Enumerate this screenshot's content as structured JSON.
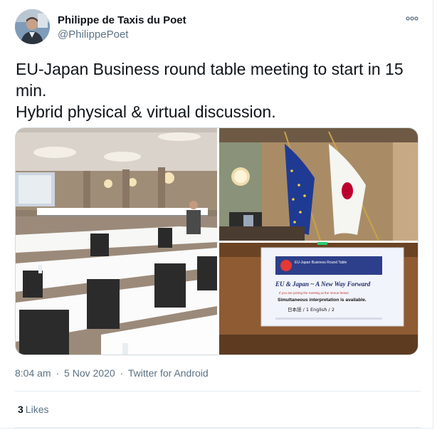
{
  "author": {
    "display_name": "Philippe de Taxis du Poet",
    "handle": "@PhilippePoet"
  },
  "more_icon": "more-options-icon",
  "tweet": {
    "lines": [
      "EU-Japan Business round table meeting to start in 15",
      "min.",
      "Hybrid physical & virtual discussion."
    ]
  },
  "media": {
    "screen": {
      "header": "EU-Japan Business Round Table",
      "title": "EU & Japan ~ A New Way Forward",
      "sub1": "If you are joining the meeting at the Venue below:",
      "sub2": "Simultaneous interpretation is available.",
      "sub3": "日本語 / 1  English / 2"
    }
  },
  "meta": {
    "time": "8:04 am",
    "separator": "·",
    "date": "5 Nov 2020",
    "source": "Twitter for Android"
  },
  "likes": {
    "count": "3",
    "label": "Likes"
  },
  "colors": {
    "text": "#0f1419",
    "secondary": "#5b7083",
    "border": "#e6ecf0",
    "eu_blue": "#1f3a93",
    "eu_star": "#f6d23a",
    "japan_red": "#bc002d"
  }
}
